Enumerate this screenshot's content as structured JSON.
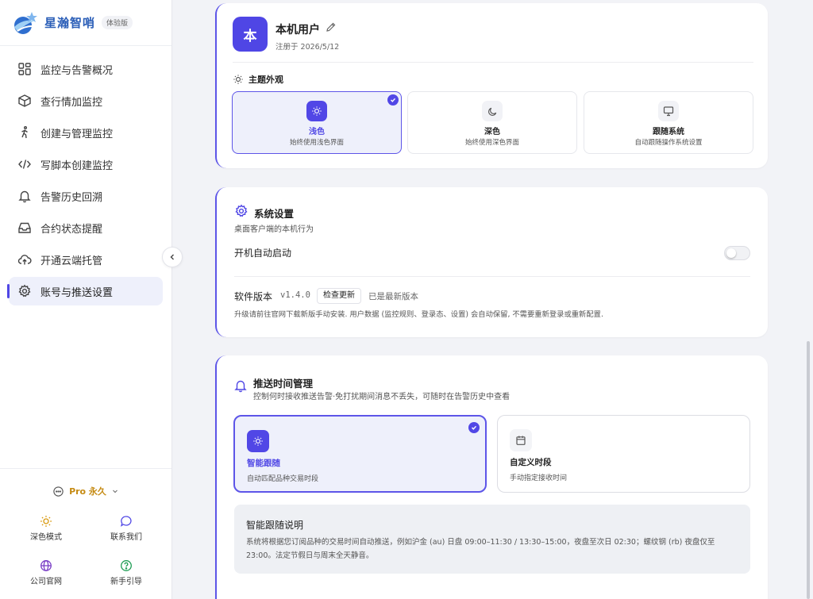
{
  "app": {
    "name": "星瀚智哨",
    "edition": "体验版"
  },
  "sidebar": {
    "items": [
      {
        "label": "监控与告警概况",
        "icon": "grid-icon"
      },
      {
        "label": "查行情加监控",
        "icon": "cube-icon"
      },
      {
        "label": "创建与管理监控",
        "icon": "person-walk-icon"
      },
      {
        "label": "写脚本创建监控",
        "icon": "code-icon"
      },
      {
        "label": "告警历史回溯",
        "icon": "bell-icon"
      },
      {
        "label": "合约状态提醒",
        "icon": "inbox-icon"
      },
      {
        "label": "开通云端托管",
        "icon": "cloud-upload-icon"
      },
      {
        "label": "账号与推送设置",
        "icon": "gear-icon"
      }
    ],
    "active_index": 7,
    "plan_label": "Pro 永久",
    "utilities": [
      {
        "label": "深色模式",
        "icon": "sun-icon"
      },
      {
        "label": "联系我们",
        "icon": "chat-icon"
      },
      {
        "label": "公司官网",
        "icon": "globe-icon"
      },
      {
        "label": "新手引导",
        "icon": "help-icon"
      }
    ]
  },
  "profile": {
    "avatar_char": "本",
    "name": "本机用户",
    "registered": "注册于 2026/5/12",
    "theme_title": "主题外观",
    "themes": [
      {
        "label": "浅色",
        "desc": "始终使用浅色界面",
        "icon": "sun-icon"
      },
      {
        "label": "深色",
        "desc": "始终使用深色界面",
        "icon": "moon-icon"
      },
      {
        "label": "跟随系统",
        "desc": "自动跟随操作系统设置",
        "icon": "monitor-icon"
      }
    ],
    "selected_theme": 0
  },
  "system": {
    "title": "系统设置",
    "subtitle": "桌面客户端的本机行为",
    "autostart_label": "开机自动启动",
    "autostart_on": false,
    "version_label": "软件版本",
    "version": "v1.4.0",
    "check_update": "检查更新",
    "latest": "已是最新版本",
    "upgrade_note": "升级请前往官网下载新版手动安装. 用户数据 (监控规则、登录态、设置) 会自动保留, 不需要重新登录或重新配置."
  },
  "push": {
    "title": "推送时间管理",
    "subtitle": "控制何时接收推送告警·免打扰期间消息不丢失，可随时在告警历史中查看",
    "modes": [
      {
        "label": "智能跟随",
        "desc": "自动匹配品种交易时段",
        "icon": "sun-icon"
      },
      {
        "label": "自定义时段",
        "desc": "手动指定接收时间",
        "icon": "calendar-icon"
      }
    ],
    "selected_mode": 0,
    "info_title": "智能跟随说明",
    "info_text": "系统将根据您订阅品种的交易时间自动推送，例如沪金 (au) 日盘 09:00–11:30 / 13:30–15:00，夜盘至次日 02:30；螺纹钢 (rb) 夜盘仅至 23:00。法定节假日与周末全天静音。"
  },
  "colors": {
    "accent": "#4f46e5",
    "pro": "#c58a12"
  }
}
